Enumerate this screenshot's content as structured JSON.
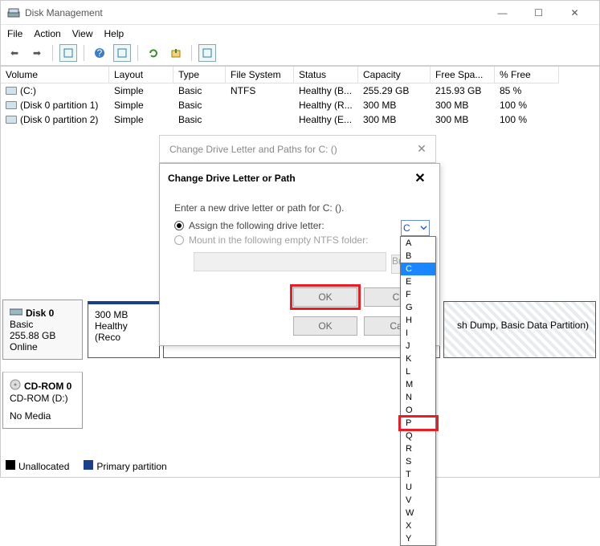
{
  "window": {
    "title": "Disk Management"
  },
  "menu": [
    "File",
    "Action",
    "View",
    "Help"
  ],
  "columns": [
    "Volume",
    "Layout",
    "Type",
    "File System",
    "Status",
    "Capacity",
    "Free Spa...",
    "% Free"
  ],
  "volumes": [
    {
      "name": "(C:)",
      "layout": "Simple",
      "type": "Basic",
      "fs": "NTFS",
      "status": "Healthy (B...",
      "cap": "255.29 GB",
      "free": "215.93 GB",
      "pct": "85 %"
    },
    {
      "name": "(Disk 0 partition 1)",
      "layout": "Simple",
      "type": "Basic",
      "fs": "",
      "status": "Healthy (R...",
      "cap": "300 MB",
      "free": "300 MB",
      "pct": "100 %"
    },
    {
      "name": "(Disk 0 partition 2)",
      "layout": "Simple",
      "type": "Basic",
      "fs": "",
      "status": "Healthy (E...",
      "cap": "300 MB",
      "free": "300 MB",
      "pct": "100 %"
    }
  ],
  "disk0": {
    "label": "Disk 0",
    "type": "Basic",
    "size": "255.88 GB",
    "state": "Online",
    "part1_size": "300 MB",
    "part1_status": "Healthy (Reco",
    "part_right": "sh Dump, Basic Data Partition)"
  },
  "cdrom": {
    "label": "CD-ROM 0",
    "sub": "CD-ROM (D:)",
    "state": "No Media"
  },
  "legend": {
    "unalloc": "Unallocated",
    "primary": "Primary partition"
  },
  "dlg1": {
    "title": "Change Drive Letter and Paths for C: ()"
  },
  "dlg2": {
    "title": "Change Drive Letter or Path",
    "prompt": "Enter a new drive letter or path for C: ().",
    "opt_assign": "Assign the following drive letter:",
    "opt_mount": "Mount in the following empty NTFS folder:",
    "browse": "Br",
    "ok": "OK",
    "cancel": "C",
    "ok2": "OK",
    "cancel2": "Ca",
    "combo_value": "C"
  },
  "letters": [
    "A",
    "B",
    "C",
    "E",
    "F",
    "G",
    "H",
    "I",
    "J",
    "K",
    "L",
    "M",
    "N",
    "O",
    "P",
    "Q",
    "R",
    "S",
    "T",
    "U",
    "V",
    "W",
    "X",
    "Y"
  ]
}
